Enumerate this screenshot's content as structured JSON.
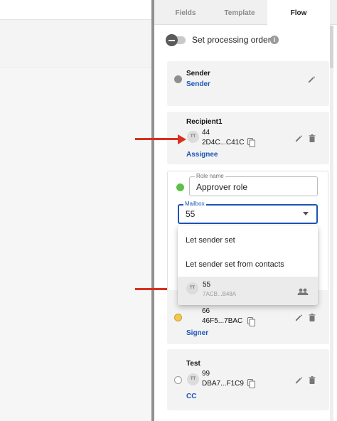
{
  "tabs": [
    {
      "label": "Fields"
    },
    {
      "label": "Template"
    },
    {
      "label": "Flow",
      "active": true
    }
  ],
  "processing_order": {
    "label": "Set processing order",
    "enabled": false
  },
  "cards": {
    "sender": {
      "name": "Sender",
      "role": "Sender"
    },
    "recipient1": {
      "name": "Recipient1",
      "avatar": "TT",
      "mailbox_number": "44",
      "mailbox_id": "2D4C...C41C",
      "role": "Assignee"
    },
    "signer": {
      "avatar": "TT",
      "mailbox_number": "66",
      "mailbox_id": "46F5...7BAC",
      "role": "Signer"
    },
    "test": {
      "name": "Test",
      "avatar": "TT",
      "mailbox_number": "99",
      "mailbox_id": "DBA7...F1C9",
      "role": "CC"
    }
  },
  "edit": {
    "role_name_label": "Role name",
    "role_name_value": "Approver role",
    "mailbox_label": "Mailbox",
    "mailbox_value": "55"
  },
  "dropdown": {
    "options": [
      {
        "label": "Let sender set"
      },
      {
        "label": "Let sender set from contacts"
      }
    ],
    "selected": {
      "avatar": "TT",
      "number": "55",
      "id": "7ACB...B48A"
    }
  },
  "colors": {
    "role_link": "#1d55b8",
    "arrow": "#d7311f",
    "sender_dot": "#8e8e8e",
    "edit_dot": "#5cc14a",
    "signer_dot": "#f2c94c",
    "test_dot": "#ffffff"
  },
  "icons": {
    "edit": "pencil-icon",
    "delete": "trash-icon",
    "copy": "copy-icon",
    "info": "info-icon",
    "dropdown": "caret-down-icon",
    "group": "people-icon"
  }
}
